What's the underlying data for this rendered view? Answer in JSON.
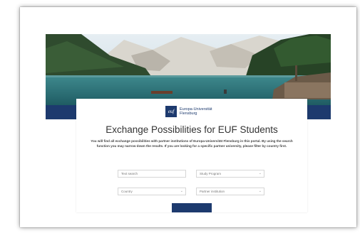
{
  "logo": {
    "line1": "Europa-Universität",
    "line2": "Flensburg",
    "mark": "euf"
  },
  "page": {
    "title": "Exchange Possibilities for EUF Students",
    "intro": "You will find all exchange possibilities with partner institutions of Europa-Universität Flensburg in this portal. By using the search function you may narrow down the results. If you are looking for a specific partner university, please filter by country first."
  },
  "filters": {
    "text_search_placeholder": "Text search",
    "study_program_placeholder": "Study Program",
    "country_placeholder": "Country",
    "partner_institution_placeholder": "Partner institution"
  },
  "colors": {
    "brand": "#1d3a6e"
  }
}
